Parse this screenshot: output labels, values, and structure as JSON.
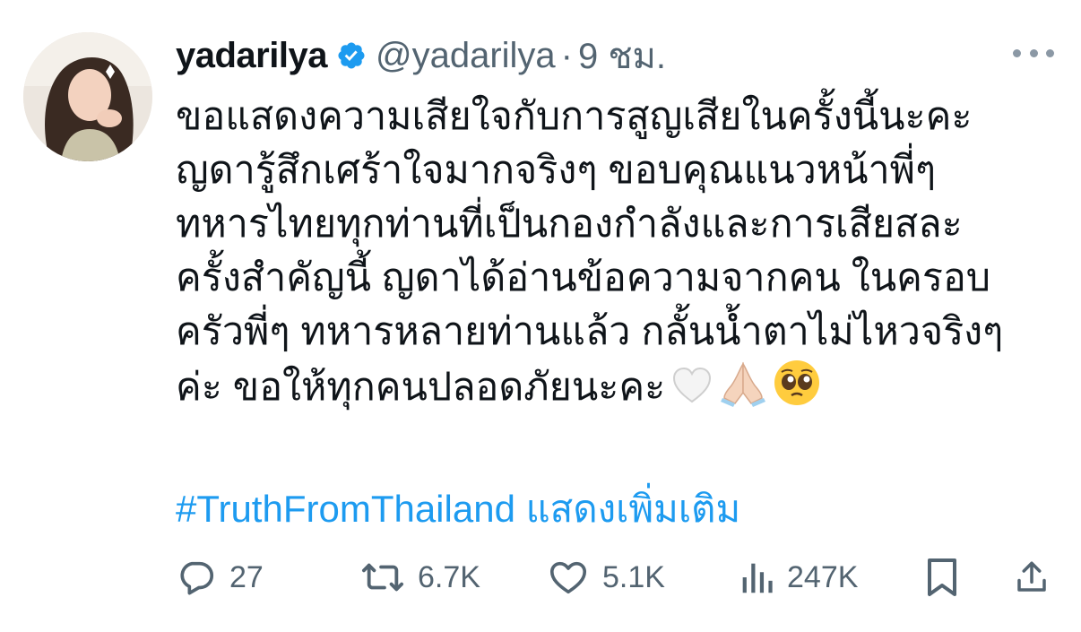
{
  "tweet": {
    "display_name": "yadarilya",
    "handle": "@yadarilya",
    "separator": "·",
    "time": "9 ชม.",
    "lines": [
      "ขอแสดงความเสียใจกับการสูญเสียในครั้งนี้นะคะ",
      "ญดารู้สึกเศร้าใจมากจริงๆ ขอบคุณแนวหน้าพี่ๆ",
      "ทหารไทยทุกท่านที่เป็นกองกำลังและการเสียสละ",
      "ครั้งสำคัญนี้ ญดาได้อ่านข้อความจากคน ในครอบ",
      "ครัวพี่ๆ ทหารหลายท่านแล้ว กลั้นน้ำตาไม่ไหวจริงๆ",
      "ค่ะ ขอให้ทุกคนปลอดภัยนะคะ"
    ],
    "emojis": [
      "white-heart-icon",
      "folded-hands-icon",
      "pleading-face-icon"
    ],
    "hashtag": "#TruthFromThailand",
    "show_more": "แสดงเพิ่มเติม"
  },
  "actions": {
    "replies": "27",
    "reposts": "6.7K",
    "likes": "5.1K",
    "views": "247K"
  },
  "colors": {
    "link": "#1d9bf0",
    "verified": "#1d9bf0",
    "muted": "#536471",
    "text": "#0f1419"
  }
}
